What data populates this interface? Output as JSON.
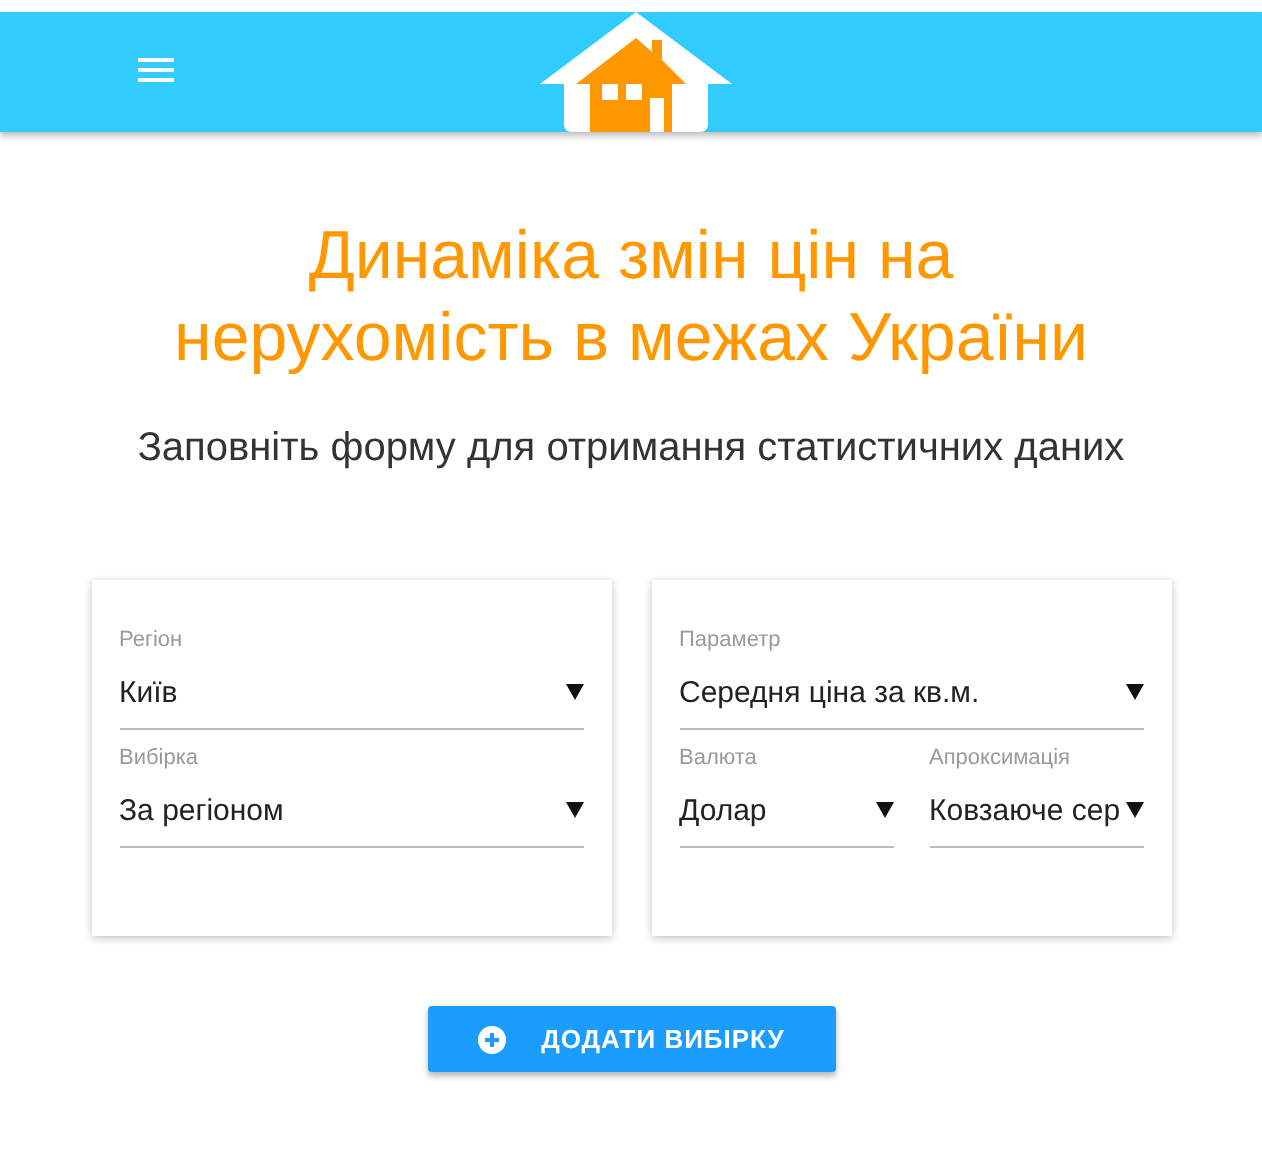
{
  "title_lines": [
    "Динаміка змін цін на",
    "нерухомість в межах України"
  ],
  "subtitle": "Заповніть форму для отримання статистичних даних",
  "cards": [
    {
      "rows": [
        [
          {
            "label": "Регіон",
            "value": "Київ"
          }
        ],
        [
          {
            "label": "Вибірка",
            "value": "За регіоном"
          }
        ]
      ]
    },
    {
      "rows": [
        [
          {
            "label": "Параметр",
            "value": "Середня ціна за кв.м."
          }
        ],
        [
          {
            "label": "Валюта",
            "value": "Долар"
          },
          {
            "label": "Апроксимація",
            "value": "Ковзаюче сер"
          }
        ]
      ]
    }
  ],
  "add_button": {
    "label": "ДОДАТИ ВИБІРКУ"
  }
}
